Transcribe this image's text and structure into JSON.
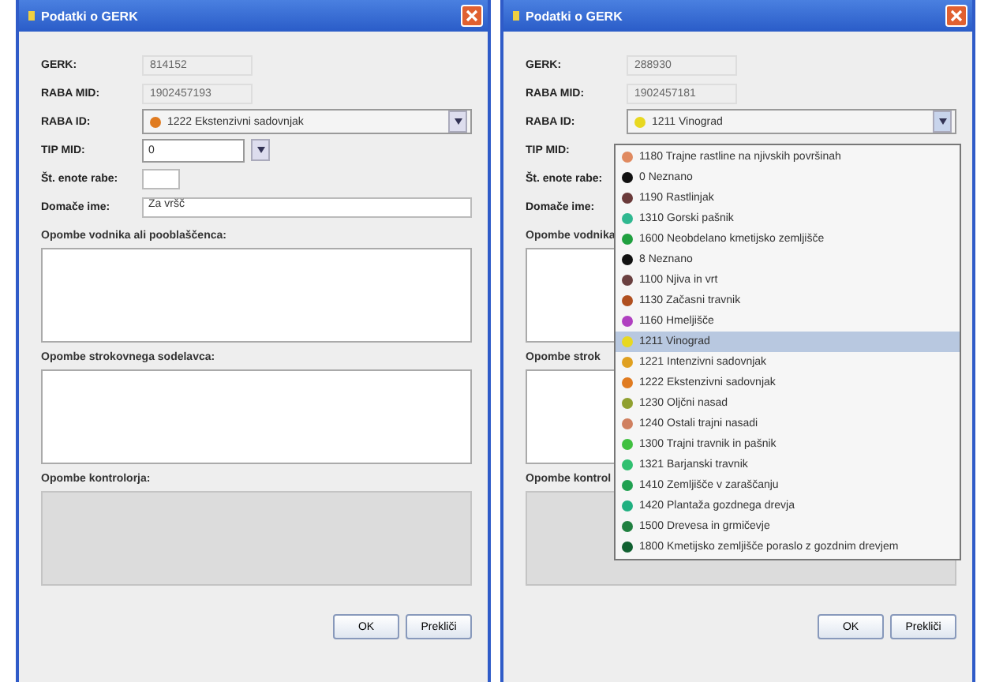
{
  "dialogs": [
    {
      "title": "Podatki o GERK",
      "fields": [
        {
          "kind": "text",
          "label": "GERK:",
          "value": "814152"
        },
        {
          "kind": "text",
          "label": "RABA MID:",
          "value": "1902457193"
        },
        {
          "kind": "select",
          "label": "RABA ID:",
          "value": "1222 Ekstenzivni sadovnjak",
          "color": "#e07b20",
          "expanded": false
        },
        {
          "kind": "spinner",
          "label": "TIP MID:",
          "value": "0"
        },
        {
          "kind": "short",
          "label": "Št. enote rabe:"
        },
        {
          "kind": "wide",
          "label": "Domače ime:",
          "value": "Za vršč"
        }
      ],
      "notes": [
        {
          "label": "Opombe vodnika ali pooblaščenca:",
          "disabled": false
        },
        {
          "label": "Opombe strokovnega sodelavca:",
          "disabled": false
        },
        {
          "label": "Opombe kontrolorja:",
          "disabled": true
        }
      ],
      "buttons": [
        "OK",
        "Prekliči"
      ]
    },
    {
      "title": "Podatki o GERK",
      "fields": [
        {
          "kind": "text",
          "label": "GERK:",
          "value": "288930"
        },
        {
          "kind": "text",
          "label": "RABA MID:",
          "value": "1902457181"
        },
        {
          "kind": "select",
          "label": "RABA ID:",
          "value": "1211 Vinograd",
          "color": "#e8d820",
          "expanded": true
        },
        {
          "kind": "label",
          "label": "TIP MID:"
        },
        {
          "kind": "label",
          "label": "Št. enote rabe:"
        },
        {
          "kind": "label",
          "label": "Domače ime:"
        }
      ],
      "notes": [
        {
          "label": "Opombe vodnika",
          "disabled": false
        },
        {
          "label": "Opombe strok",
          "disabled": false
        },
        {
          "label": "Opombe kontrol",
          "disabled": true
        }
      ],
      "buttons": [
        "OK",
        "Prekliči"
      ],
      "options": [
        {
          "label": "1180 Trajne rastline na njivskih površinah",
          "color": "#e08a60",
          "selected": false
        },
        {
          "label": "0 Neznano",
          "color": "#111111",
          "selected": false
        },
        {
          "label": "1190 Rastlinjak",
          "color": "#6a3a3a",
          "selected": false
        },
        {
          "label": "1310 Gorski pašnik",
          "color": "#30b890",
          "selected": false
        },
        {
          "label": "1600 Neobdelano kmetijsko zemljišče",
          "color": "#20a040",
          "selected": false
        },
        {
          "label": "8 Neznano",
          "color": "#111111",
          "selected": false
        },
        {
          "label": "1100 Njiva in vrt",
          "color": "#6a4040",
          "selected": false
        },
        {
          "label": "1130 Začasni travnik",
          "color": "#b05020",
          "selected": false
        },
        {
          "label": "1160 Hmeljišče",
          "color": "#b040c0",
          "selected": false
        },
        {
          "label": "1211 Vinograd",
          "color": "#e8d820",
          "selected": true
        },
        {
          "label": "1221 Intenzivni sadovnjak",
          "color": "#e0a020",
          "selected": false
        },
        {
          "label": "1222 Ekstenzivni sadovnjak",
          "color": "#e07b20",
          "selected": false
        },
        {
          "label": "1230 Oljčni nasad",
          "color": "#90a030",
          "selected": false
        },
        {
          "label": "1240 Ostali trajni nasadi",
          "color": "#d08060",
          "selected": false
        },
        {
          "label": "1300 Trajni travnik in pašnik",
          "color": "#40c040",
          "selected": false
        },
        {
          "label": "1321 Barjanski travnik",
          "color": "#30c070",
          "selected": false
        },
        {
          "label": "1410 Zemljišče v zaraščanju",
          "color": "#20a050",
          "selected": false
        },
        {
          "label": "1420 Plantaža gozdnega drevja",
          "color": "#20b080",
          "selected": false
        },
        {
          "label": "1500 Drevesa in grmičevje",
          "color": "#208040",
          "selected": false
        },
        {
          "label": "1800 Kmetijsko zemljišče poraslo z gozdnim drevjem",
          "color": "#106030",
          "selected": false
        }
      ]
    }
  ]
}
